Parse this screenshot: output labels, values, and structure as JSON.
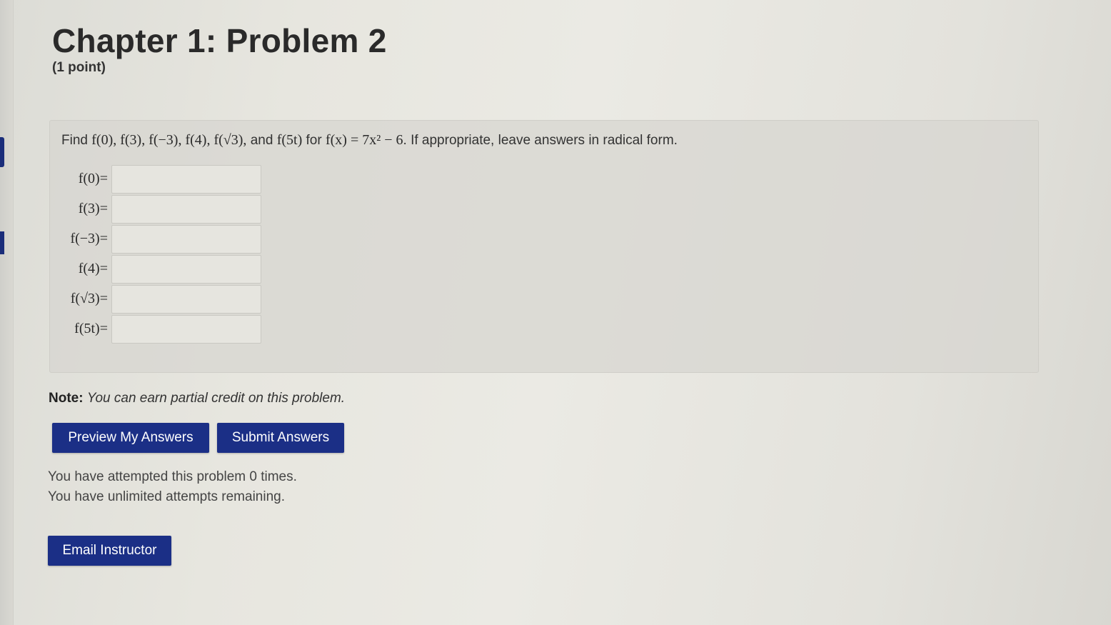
{
  "problem": {
    "title": "Chapter 1: Problem 2",
    "points": "(1 point)",
    "statement": {
      "find_word": "Find",
      "functions": "f(0), f(3), f(−3), f(4), f(√3),",
      "and_word": "and",
      "last_function": "f(5t)",
      "for_word": "for",
      "equation": "f(x) = 7x² − 6",
      "instruction": ". If appropriate, leave answers in radical form."
    },
    "answers": [
      {
        "label": "f(0)=",
        "value": ""
      },
      {
        "label": "f(3)=",
        "value": ""
      },
      {
        "label": "f(−3)=",
        "value": ""
      },
      {
        "label": "f(4)=",
        "value": ""
      },
      {
        "label": "f(√3)=",
        "value": ""
      },
      {
        "label": "f(5t)=",
        "value": ""
      }
    ]
  },
  "note": {
    "label": "Note:",
    "text": "You can earn partial credit on this problem."
  },
  "buttons": {
    "preview": "Preview My Answers",
    "submit": "Submit Answers",
    "email": "Email Instructor"
  },
  "attempts": {
    "count_text": "You have attempted this problem 0 times.",
    "remaining_text": "You have unlimited attempts remaining."
  },
  "colors": {
    "button_bg": "#1b2f86",
    "button_text": "#ffffff",
    "side_marker": "#1a2d7a"
  }
}
